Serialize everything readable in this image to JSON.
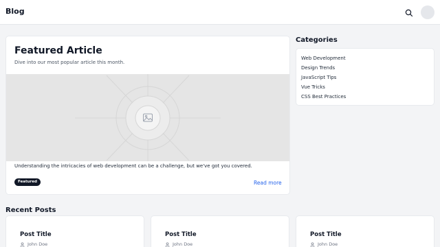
{
  "header": {
    "brand": "Blog",
    "search_icon": "search-icon",
    "avatar_icon": "avatar"
  },
  "featured": {
    "title": "Featured Article",
    "subtitle": "Dive into our most popular article this month.",
    "image_icon": "image-placeholder-icon",
    "excerpt": "Understanding the intricacies of web development can be a challenge, but we've got you covered.",
    "badge": "Featured",
    "read_more": "Read more"
  },
  "categories": {
    "heading": "Categories",
    "items": [
      "Web Development",
      "Design Trends",
      "JavaScript Tips",
      "Vue Tricks",
      "CSS Best Practices"
    ]
  },
  "recent": {
    "heading": "Recent Posts",
    "posts": [
      {
        "title": "Post Title",
        "author": "John Doe"
      },
      {
        "title": "Post Title",
        "author": "John Doe"
      },
      {
        "title": "Post Title",
        "author": "John Doe"
      }
    ]
  },
  "colors": {
    "background": "#f3f4f6",
    "card": "#ffffff",
    "text": "#111827",
    "link": "#2563eb",
    "badge": "#111827",
    "image_placeholder": "#e5e5e5"
  }
}
